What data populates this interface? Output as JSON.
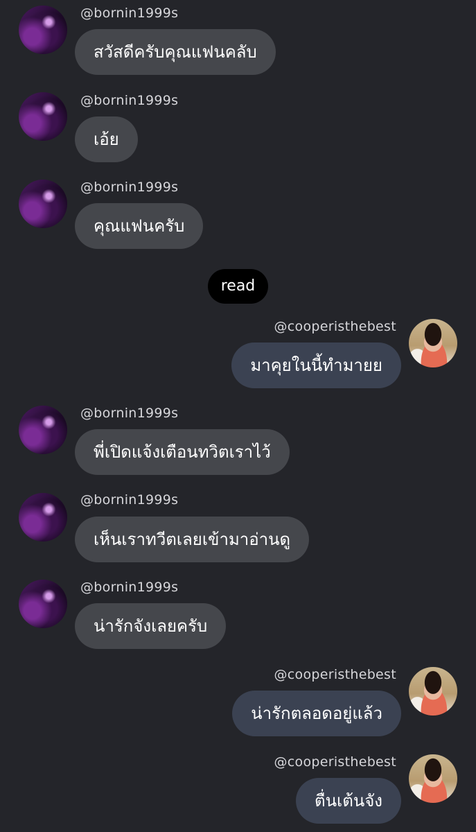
{
  "messages": [
    {
      "side": "left",
      "user": "@bornin1999s",
      "text": "สวัสดีครับคุณแฟนคลับ"
    },
    {
      "side": "left",
      "user": "@bornin1999s",
      "text": "เอ้ย"
    },
    {
      "side": "left",
      "user": "@bornin1999s",
      "text": "คุณแฟนครับ"
    },
    {
      "side": "right",
      "user": "@cooperisthebest",
      "text": "มาคุยในนี้ทำมายย"
    },
    {
      "side": "left",
      "user": "@bornin1999s",
      "text": "พี่เปิดแจ้งเตือนทวิตเราไว้"
    },
    {
      "side": "left",
      "user": "@bornin1999s",
      "text": "เห็นเราทวีตเลยเข้ามาอ่านดู"
    },
    {
      "side": "left",
      "user": "@bornin1999s",
      "text": "น่ารักจังเลยครับ"
    },
    {
      "side": "right",
      "user": "@cooperisthebest",
      "text": "น่ารักตลอดอยู่แล้ว"
    },
    {
      "side": "right",
      "user": "@cooperisthebest",
      "text": "ตื่นเต้นจัง"
    }
  ],
  "read_indicator": "read",
  "colors": {
    "background": "#24252a",
    "bubble_left": "#45474c",
    "bubble_right": "#3b4252",
    "username": "#d6d6da"
  }
}
